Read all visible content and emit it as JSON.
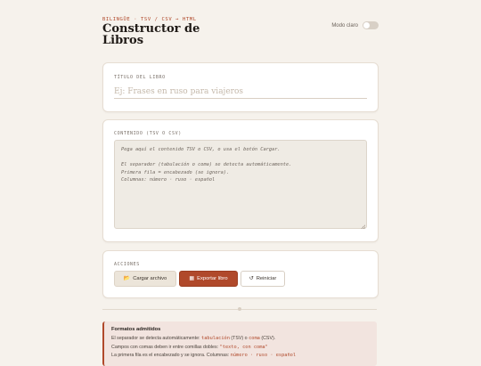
{
  "header": {
    "eyebrow": "BILINGÜE · TSV / CSV → HTML",
    "title_line1": "Constructor de",
    "title_line2": "Libros",
    "toggle_label": "Modo claro"
  },
  "book_title": {
    "label": "TÍTULO DEL LIBRO",
    "placeholder": "Ej: Frases en ruso para viajeros",
    "value": ""
  },
  "content": {
    "label": "CONTENIDO (TSV O CSV)",
    "placeholder": "Pega aquí el contenido TSV o CSV, o usa el botón Cargar.\n\nEl separador (tabulación o coma) se detecta automáticamente.\nPrimera fila = encabezado (se ignora).\nColumnas: número · ruso · español"
  },
  "actions": {
    "label": "ACCIONES",
    "load_label": "Cargar archivo",
    "export_label": "Exportar libro",
    "reset_label": "Reiniciar"
  },
  "info": {
    "title": "Formatos admitidos",
    "line1_pre": "El separador se detecta automáticamente: ",
    "line1_code1": "tabulación",
    "line1_mid1": " (TSV) o ",
    "line1_code2": "coma",
    "line1_post": " (CSV).",
    "line2_pre": "Campos con comas deben ir entre comillas dobles: ",
    "line2_code": "\"texto, con coma\"",
    "line3_pre": "La primera fila es el encabezado y se ignora. Columnas: ",
    "line3_code": "número · ruso · español"
  },
  "colors": {
    "accent": "#b0492b",
    "background": "#f6f2ec"
  }
}
